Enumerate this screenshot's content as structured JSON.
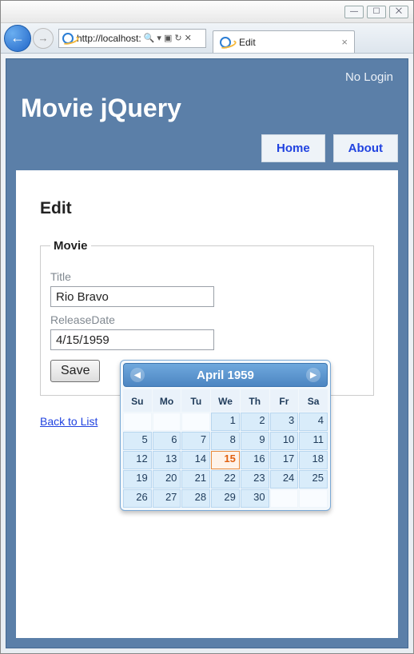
{
  "window": {
    "min": "—",
    "max": "☐",
    "close": "⨉"
  },
  "browser": {
    "url": "http://localhost:",
    "search_hint": "🔍",
    "tab_title": "Edit"
  },
  "header": {
    "login_text": "No Login",
    "brand": "Movie jQuery",
    "nav": {
      "home": "Home",
      "about": "About"
    }
  },
  "page": {
    "heading": "Edit",
    "legend": "Movie",
    "title_label": "Title",
    "title_value": "Rio Bravo",
    "date_label": "ReleaseDate",
    "date_value": "4/15/1959",
    "save": "Save",
    "back": "Back to List"
  },
  "datepicker": {
    "month_label": "April 1959",
    "dows": [
      "Su",
      "Mo",
      "Tu",
      "We",
      "Th",
      "Fr",
      "Sa"
    ],
    "leading_blanks": 3,
    "days": [
      1,
      2,
      3,
      4,
      5,
      6,
      7,
      8,
      9,
      10,
      11,
      12,
      13,
      14,
      15,
      16,
      17,
      18,
      19,
      20,
      21,
      22,
      23,
      24,
      25,
      26,
      27,
      28,
      29,
      30
    ],
    "trailing_blanks": 2,
    "selected": 15
  }
}
